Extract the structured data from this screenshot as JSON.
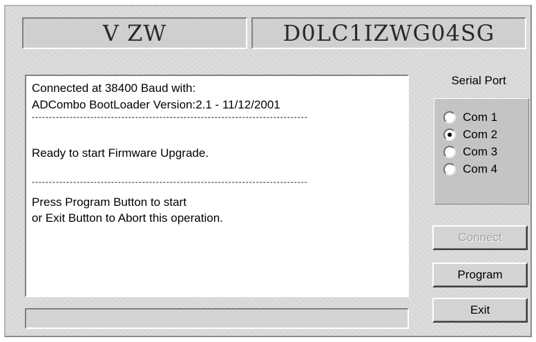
{
  "header": {
    "carrier": "V ZW",
    "serial_number": "D0LC1IZWG04SG"
  },
  "log": {
    "lines": [
      {
        "kind": "text",
        "text": "Connected at 38400 Baud with:"
      },
      {
        "kind": "text",
        "text": "ADCombo BootLoader Version:2.1 - 11/12/2001"
      },
      {
        "kind": "dash",
        "text": "--------------------------------------------------------------------------------"
      },
      {
        "kind": "blank",
        "text": ""
      },
      {
        "kind": "text",
        "text": "Ready to start Firmware Upgrade."
      },
      {
        "kind": "blank",
        "text": ""
      },
      {
        "kind": "dash",
        "text": "--------------------------------------------------------------------------------"
      },
      {
        "kind": "text",
        "text": "Press Program Button to start"
      },
      {
        "kind": "text",
        "text": "or Exit Button to Abort this operation."
      }
    ]
  },
  "progress": {
    "value": 0
  },
  "serial_port": {
    "title": "Serial Port",
    "selected": "Com 2",
    "options": [
      "Com 1",
      "Com 2",
      "Com 3",
      "Com 4"
    ]
  },
  "buttons": {
    "connect_label": "Connect",
    "connect_enabled": false,
    "program_label": "Program",
    "exit_label": "Exit"
  },
  "colors": {
    "progress_fill": "#000080",
    "disabled_text": "#a0a0a0"
  }
}
